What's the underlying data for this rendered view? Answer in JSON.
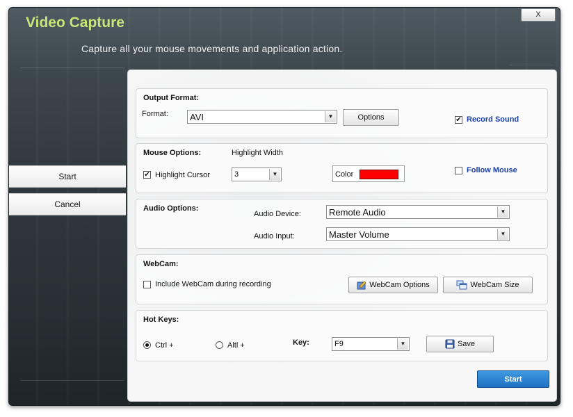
{
  "window": {
    "title": "Video Capture",
    "subtitle": "Capture all your mouse movements and application action.",
    "close_label": "X"
  },
  "sidebar": {
    "items": [
      {
        "label": "Start"
      },
      {
        "label": "Cancel"
      }
    ]
  },
  "output_format": {
    "heading": "Output Format:",
    "format_label": "Format:",
    "format_value": "AVI",
    "options_button": "Options",
    "record_sound_label": "Record Sound",
    "record_sound_checked": true
  },
  "mouse_options": {
    "heading": "Mouse Options:",
    "highlight_width_label": "Highlight Width",
    "highlight_cursor_label": "Highlight Cursor",
    "highlight_cursor_checked": true,
    "highlight_width_value": "3",
    "color_label": "Color",
    "color_value": "#ff0000",
    "follow_mouse_label": "Follow Mouse",
    "follow_mouse_checked": false
  },
  "audio_options": {
    "heading": "Audio Options:",
    "device_label": "Audio Device:",
    "device_value": "Remote Audio",
    "input_label": "Audio Input:",
    "input_value": "Master Volume"
  },
  "webcam": {
    "heading": "WebCam:",
    "include_label": "Include WebCam during recording",
    "include_checked": false,
    "options_button": "WebCam Options",
    "size_button": "WebCam Size"
  },
  "hot_keys": {
    "heading": "Hot Keys:",
    "ctrl_label": "Ctrl +",
    "ctrl_selected": true,
    "alt_label": "Altl +",
    "alt_selected": false,
    "key_label": "Key:",
    "key_value": "F9",
    "save_button": "Save"
  },
  "footer": {
    "start_button": "Start"
  },
  "colors": {
    "title": "#c7e57a",
    "link": "#1c3fa8",
    "start_button": "#2a83d4"
  }
}
